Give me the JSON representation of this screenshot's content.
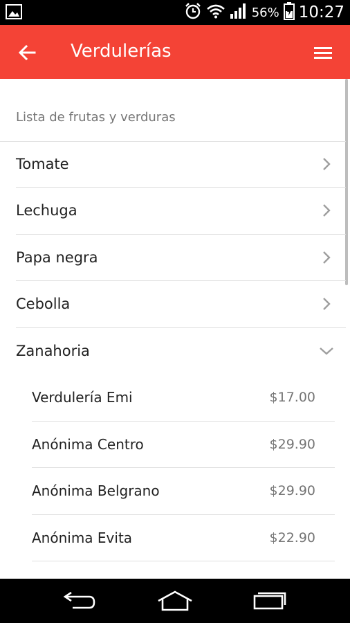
{
  "status_bar": {
    "battery_percent": "56%",
    "time": "10:27",
    "icons": [
      "image-notification-icon",
      "alarm-icon",
      "wifi-icon",
      "signal-icon",
      "battery-charging-icon"
    ]
  },
  "app_bar": {
    "title": "Verdulerías",
    "back_icon": "arrow-back-icon",
    "menu_icon": "menu-icon",
    "color": "#f44336"
  },
  "list": {
    "subheader": "Lista de frutas y verduras",
    "items": [
      {
        "label": "Tomate",
        "expanded": false
      },
      {
        "label": "Lechuga",
        "expanded": false
      },
      {
        "label": "Papa negra",
        "expanded": false
      },
      {
        "label": "Cebolla",
        "expanded": false
      },
      {
        "label": "Zanahoria",
        "expanded": true
      }
    ],
    "expanded_item": {
      "stores": [
        {
          "name": "Verdulería Emi",
          "price": "$17.00"
        },
        {
          "name": "Anónima Centro",
          "price": "$29.90"
        },
        {
          "name": "Anónima Belgrano",
          "price": "$29.90"
        },
        {
          "name": "Anónima Evita",
          "price": "$22.90"
        }
      ]
    }
  },
  "nav_bar": {
    "buttons": [
      "back-nav-icon",
      "home-nav-icon",
      "recents-nav-icon"
    ]
  }
}
